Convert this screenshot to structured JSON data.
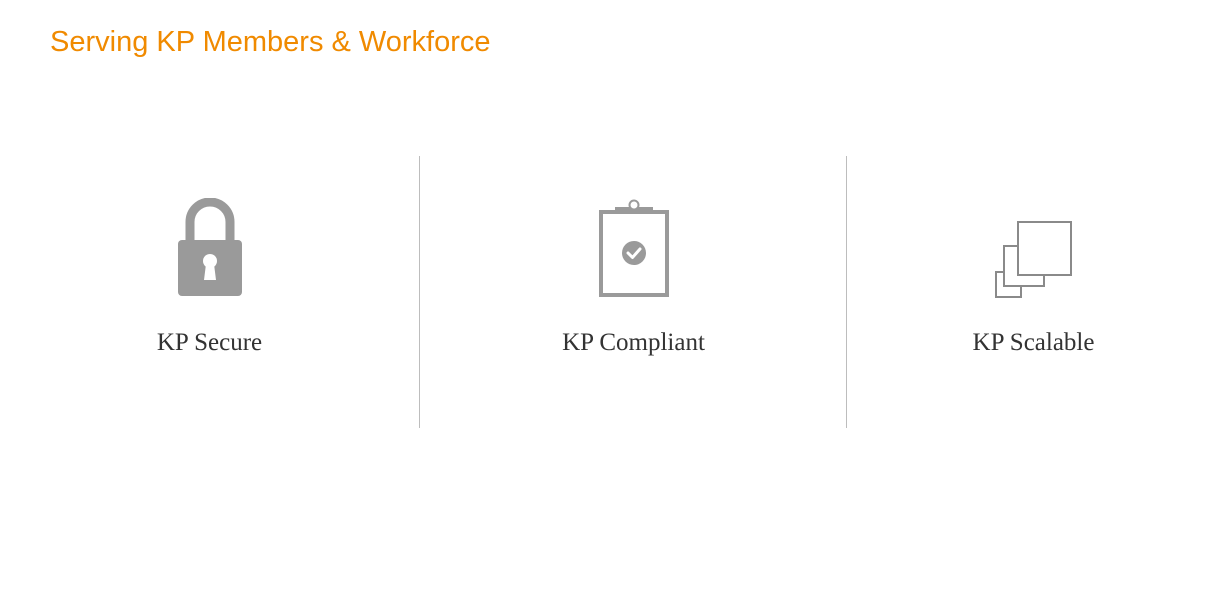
{
  "header": {
    "title": "Serving KP Members & Workforce"
  },
  "colors": {
    "accent": "#f08a00",
    "icon": "#9a9a9a",
    "text": "#333333",
    "divider": "#bdbdbd"
  },
  "features": [
    {
      "label": "KP Secure",
      "icon": "padlock-icon"
    },
    {
      "label": "KP Compliant",
      "icon": "clipboard-check-icon"
    },
    {
      "label": "KP Scalable",
      "icon": "stacked-squares-icon"
    }
  ]
}
